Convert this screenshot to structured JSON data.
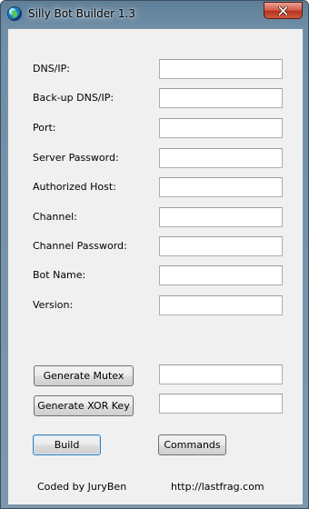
{
  "window": {
    "title": "Silly Bot Builder 1.3"
  },
  "form": {
    "fields": [
      {
        "label": "DNS/IP:",
        "value": ""
      },
      {
        "label": "Back-up DNS/IP:",
        "value": ""
      },
      {
        "label": "Port:",
        "value": ""
      },
      {
        "label": "Server Password:",
        "value": ""
      },
      {
        "label": "Authorized Host:",
        "value": ""
      },
      {
        "label": "Channel:",
        "value": ""
      },
      {
        "label": "Channel Password:",
        "value": ""
      },
      {
        "label": "Bot Name:",
        "value": ""
      },
      {
        "label": "Version:",
        "value": ""
      }
    ]
  },
  "generators": {
    "mutex": {
      "button_label": "Generate Mutex",
      "value": ""
    },
    "xor": {
      "button_label": "Generate XOR Key",
      "value": ""
    }
  },
  "actions": {
    "build_label": "Build",
    "commands_label": "Commands"
  },
  "footer": {
    "credit": "Coded by JuryBen",
    "url": "http://lastfrag.com"
  }
}
